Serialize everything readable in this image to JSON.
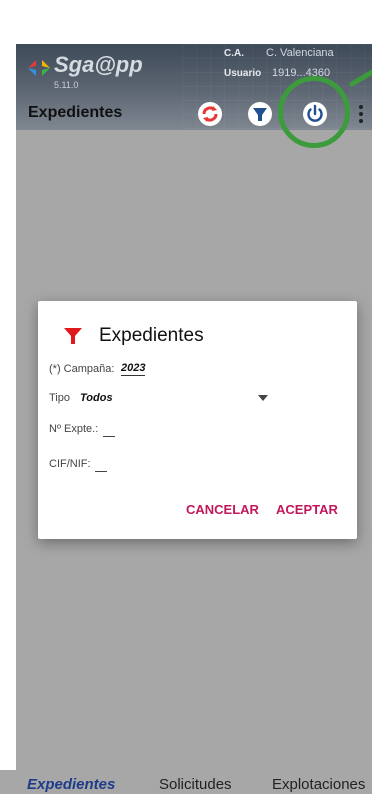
{
  "header": {
    "app_name": "Sga@pp",
    "version": "5.11.0",
    "region_label": "C.A.",
    "region_value": "C. Valenciana",
    "user_label": "Usuario",
    "user_value": "1919...4360"
  },
  "toolbar": {
    "title": "Expedientes"
  },
  "dialog": {
    "title": "Expedientes",
    "campaign_label": "(*) Campaña:",
    "campaign_value": "2023",
    "type_label": "Tipo",
    "type_value": "Todos",
    "expediente_label": "Nº Expte.:",
    "cif_label": "CIF/NIF:",
    "cancel_label": "CANCELAR",
    "accept_label": "ACEPTAR"
  },
  "bottom_nav": {
    "items": [
      "Expedientes",
      "Solicitudes",
      "Explotaciones"
    ],
    "active": "Expedientes"
  },
  "colors": {
    "accent": "#c2185b",
    "highlight": "#3c9c3c",
    "nav_active": "#1e3c8a",
    "scrim": "#a7a7a7"
  },
  "icons": {
    "sync": "sync-icon",
    "filter": "filter-icon",
    "power": "power-icon",
    "more": "more-vert-icon"
  }
}
